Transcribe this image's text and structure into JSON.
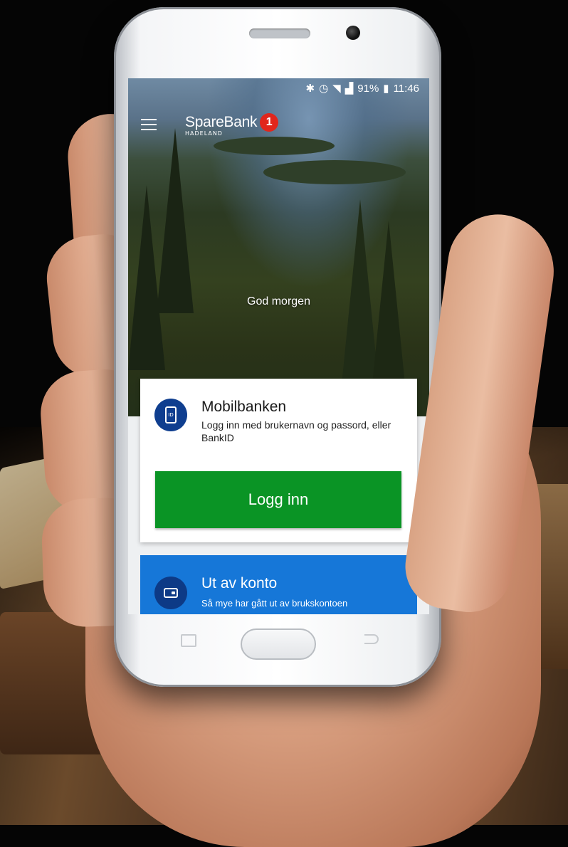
{
  "status_bar": {
    "icons": [
      "bluetooth-icon",
      "alarm-icon",
      "volte-icon",
      "wifi-icon",
      "signal-icon"
    ],
    "battery": "91%",
    "time": "11:46"
  },
  "header": {
    "logo_text": "SpareBank",
    "logo_badge": "1",
    "logo_subtitle": "HADELAND"
  },
  "hero": {
    "greeting": "God morgen"
  },
  "login_card": {
    "title": "Mobilbanken",
    "description": "Logg inn med brukernavn og passord, eller BankID",
    "icon_label": "ID",
    "button_label": "Logg inn"
  },
  "account_card": {
    "title": "Ut av konto",
    "description": "Så mye har gått ut av brukskontoen"
  },
  "colors": {
    "login_button": "#0a9425",
    "account_card": "#1677d8",
    "icon_circle": "#0f3e8f",
    "brand_badge": "#e1261c"
  }
}
